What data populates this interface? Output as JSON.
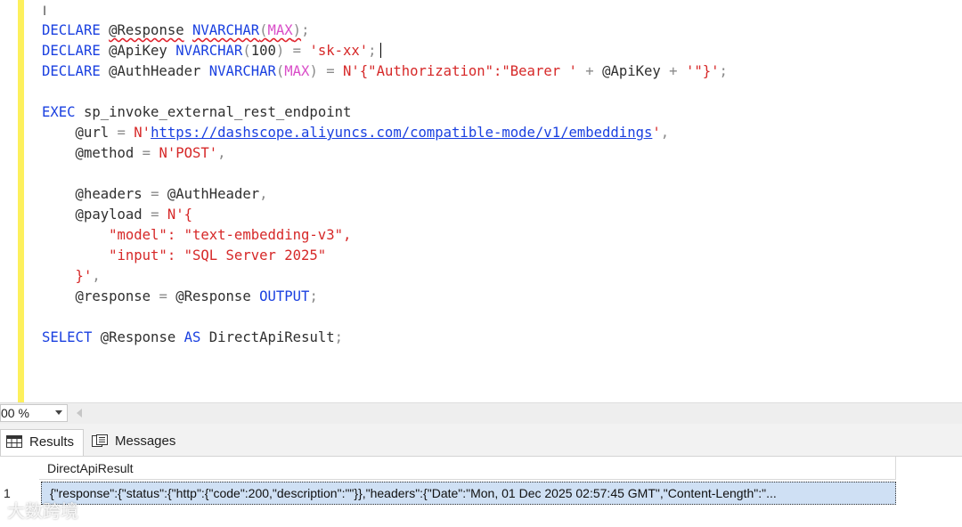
{
  "editor": {
    "lines": [
      [
        {
          "t": "DECLARE",
          "c": "kw"
        },
        {
          "t": " ",
          "c": "plain"
        },
        {
          "t": "@Response",
          "c": "var",
          "s": true
        },
        {
          "t": " ",
          "c": "plain"
        },
        {
          "t": "NVARCHAR",
          "c": "kw",
          "s": true
        },
        {
          "t": "(",
          "c": "op",
          "s": true
        },
        {
          "t": "MAX",
          "c": "fn",
          "s": true
        },
        {
          "t": ")",
          "c": "op",
          "s": true
        },
        {
          "t": ";",
          "c": "op"
        }
      ],
      [
        {
          "t": "DECLARE",
          "c": "kw"
        },
        {
          "t": " @ApiKey ",
          "c": "var"
        },
        {
          "t": "NVARCHAR",
          "c": "kw"
        },
        {
          "t": "(",
          "c": "op"
        },
        {
          "t": "100",
          "c": "var"
        },
        {
          "t": ") = ",
          "c": "op"
        },
        {
          "t": "'sk-xx'",
          "c": "str"
        },
        {
          "t": ";",
          "c": "op"
        }
      ],
      [
        {
          "t": "DECLARE",
          "c": "kw"
        },
        {
          "t": " @AuthHeader ",
          "c": "var"
        },
        {
          "t": "NVARCHAR",
          "c": "kw"
        },
        {
          "t": "(",
          "c": "op"
        },
        {
          "t": "MAX",
          "c": "fn"
        },
        {
          "t": ") = ",
          "c": "op"
        },
        {
          "t": "N'{\"Authorization\":\"Bearer '",
          "c": "str"
        },
        {
          "t": " + ",
          "c": "op"
        },
        {
          "t": "@ApiKey",
          "c": "var"
        },
        {
          "t": " + ",
          "c": "op"
        },
        {
          "t": "'\"}'",
          "c": "str"
        },
        {
          "t": ";",
          "c": "op"
        }
      ],
      [],
      [
        {
          "t": "EXEC",
          "c": "kw"
        },
        {
          "t": " sp_invoke_external_rest_endpoint",
          "c": "var"
        }
      ],
      [
        {
          "t": "    @url ",
          "c": "var"
        },
        {
          "t": "= ",
          "c": "op"
        },
        {
          "t": "N'",
          "c": "str"
        },
        {
          "t": "https://dashscope.aliyuncs.com/compatible-mode/v1/embeddings",
          "c": "url"
        },
        {
          "t": "'",
          "c": "str"
        },
        {
          "t": ",",
          "c": "op"
        }
      ],
      [
        {
          "t": "    @method ",
          "c": "var"
        },
        {
          "t": "= ",
          "c": "op"
        },
        {
          "t": "N'POST'",
          "c": "str"
        },
        {
          "t": ",",
          "c": "op"
        }
      ],
      [],
      [
        {
          "t": "    @headers ",
          "c": "var"
        },
        {
          "t": "= ",
          "c": "op"
        },
        {
          "t": "@AuthHeader",
          "c": "var"
        },
        {
          "t": ",",
          "c": "op"
        }
      ],
      [
        {
          "t": "    @payload ",
          "c": "var"
        },
        {
          "t": "= ",
          "c": "op"
        },
        {
          "t": "N'{",
          "c": "str"
        }
      ],
      [
        {
          "t": "        \"model\": \"text-embedding-v3\",",
          "c": "str"
        }
      ],
      [
        {
          "t": "        \"input\": \"SQL Server 2025\"",
          "c": "str"
        }
      ],
      [
        {
          "t": "    }'",
          "c": "str"
        },
        {
          "t": ",",
          "c": "op"
        }
      ],
      [
        {
          "t": "    @response ",
          "c": "var"
        },
        {
          "t": "= ",
          "c": "op"
        },
        {
          "t": "@Response ",
          "c": "var"
        },
        {
          "t": "OUTPUT",
          "c": "kw"
        },
        {
          "t": ";",
          "c": "op"
        }
      ],
      [],
      [
        {
          "t": "SELECT",
          "c": "kw"
        },
        {
          "t": " @Response ",
          "c": "var"
        },
        {
          "t": "AS",
          "c": "kw"
        },
        {
          "t": " DirectApiResult",
          "c": "var"
        },
        {
          "t": ";",
          "c": "op"
        }
      ]
    ]
  },
  "zoom": {
    "value": "00 %"
  },
  "tabs": {
    "results": "Results",
    "messages": "Messages"
  },
  "grid": {
    "column_header": "DirectApiResult",
    "row_number": "1",
    "cell_value": "{\"response\":{\"status\":{\"http\":{\"code\":200,\"description\":\"\"}},\"headers\":{\"Date\":\"Mon, 01 Dec 2025 02:57:45 GMT\",\"Content-Length\":\"..."
  },
  "watermark": "大数跨境"
}
